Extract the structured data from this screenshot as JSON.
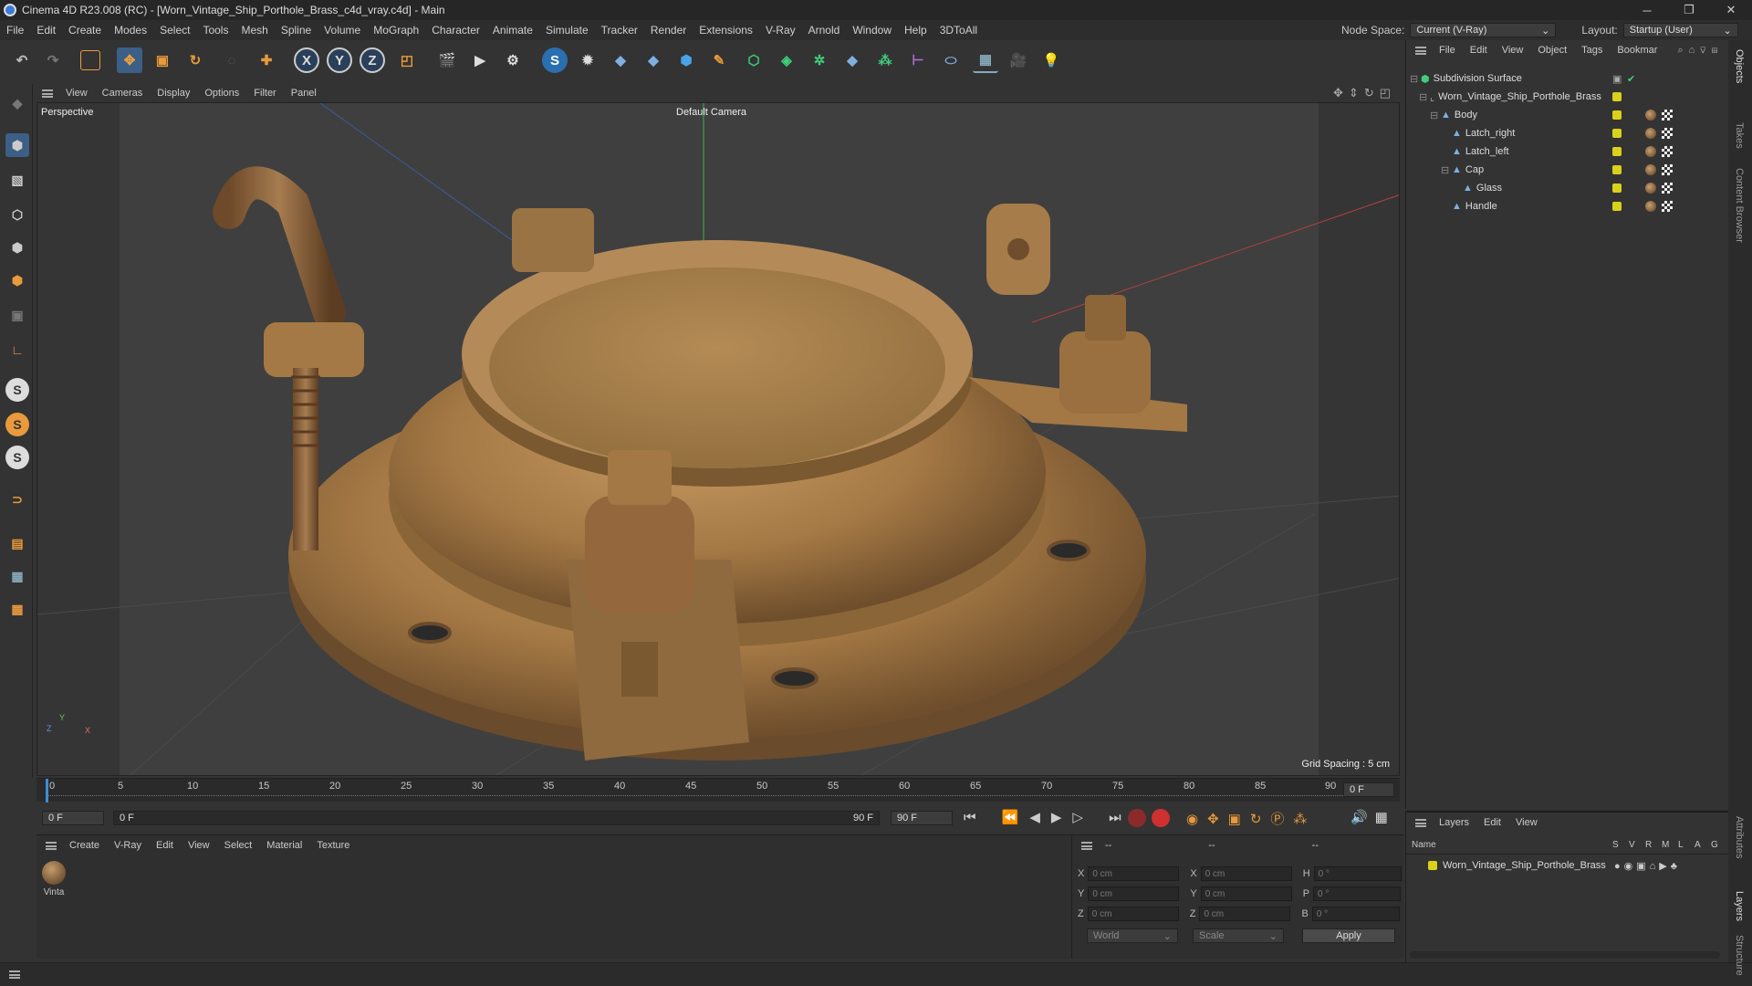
{
  "window": {
    "title": "Cinema 4D R23.008 (RC) - [Worn_Vintage_Ship_Porthole_Brass_c4d_vray.c4d] - Main",
    "min": "─",
    "max": "❐",
    "close": "✕"
  },
  "menu": [
    "File",
    "Edit",
    "Create",
    "Modes",
    "Select",
    "Tools",
    "Mesh",
    "Spline",
    "Volume",
    "MoGraph",
    "Character",
    "Animate",
    "Simulate",
    "Tracker",
    "Render",
    "Extensions",
    "V-Ray",
    "Arnold",
    "Window",
    "Help",
    "3DToAll"
  ],
  "node_space": {
    "label": "Node Space:",
    "value": "Current (V-Ray)"
  },
  "layout": {
    "label": "Layout:",
    "value": "Startup (User)"
  },
  "viewport": {
    "menu": [
      "View",
      "Cameras",
      "Display",
      "Options",
      "Filter",
      "Panel"
    ],
    "label": "Perspective",
    "camera": "Default Camera",
    "grid_spacing": "Grid Spacing : 5 cm",
    "axis_y": "Y",
    "axis_x": "X",
    "axis_z": "Z"
  },
  "timeline": {
    "ticks": [
      "0",
      "5",
      "10",
      "15",
      "20",
      "25",
      "30",
      "35",
      "40",
      "45",
      "50",
      "55",
      "60",
      "65",
      "70",
      "75",
      "80",
      "85",
      "90"
    ],
    "current_frame": "0 F",
    "start_field": "0 F",
    "range_start": "0 F",
    "range_end": "90 F",
    "end_field": "90 F"
  },
  "materials": {
    "menu": [
      "Create",
      "V-Ray",
      "Edit",
      "View",
      "Select",
      "Material",
      "Texture"
    ],
    "items": [
      {
        "name": "Vinta"
      }
    ]
  },
  "attributes": {
    "header1": "--",
    "header2": "--",
    "header3": "--",
    "rows": [
      {
        "a": "X",
        "av": "0 cm",
        "b": "X",
        "bv": "0 cm",
        "c": "H",
        "cv": "0 °"
      },
      {
        "a": "Y",
        "av": "0 cm",
        "b": "Y",
        "bv": "0 cm",
        "c": "P",
        "cv": "0 °"
      },
      {
        "a": "Z",
        "av": "0 cm",
        "b": "Z",
        "bv": "0 cm",
        "c": "B",
        "cv": "0 °"
      }
    ],
    "coord_mode": "World",
    "scale_mode": "Scale",
    "apply": "Apply"
  },
  "objects": {
    "menu": [
      "File",
      "Edit",
      "View",
      "Object",
      "Tags",
      "Bookmar"
    ],
    "tree": [
      {
        "name": "Subdivision Surface",
        "indent": 0
      },
      {
        "name": "Worn_Vintage_Ship_Porthole_Brass",
        "indent": 1
      },
      {
        "name": "Body",
        "indent": 2
      },
      {
        "name": "Latch_right",
        "indent": 3
      },
      {
        "name": "Latch_left",
        "indent": 3
      },
      {
        "name": "Cap",
        "indent": 3
      },
      {
        "name": "Glass",
        "indent": 4
      },
      {
        "name": "Handle",
        "indent": 3
      }
    ]
  },
  "layers": {
    "menu": [
      "Layers",
      "Edit",
      "View"
    ],
    "col_name": "Name",
    "cols": [
      "S",
      "V",
      "R",
      "M",
      "L",
      "A",
      "G"
    ],
    "items": [
      {
        "name": "Worn_Vintage_Ship_Porthole_Brass"
      }
    ]
  },
  "right_tabs": [
    "Objects",
    "Takes",
    "Content Browser",
    "Attributes",
    "Layers",
    "Structure"
  ],
  "colors": {
    "accent": "#3a8fd9",
    "layer": "#d9d11b",
    "brass": "#b08552"
  }
}
